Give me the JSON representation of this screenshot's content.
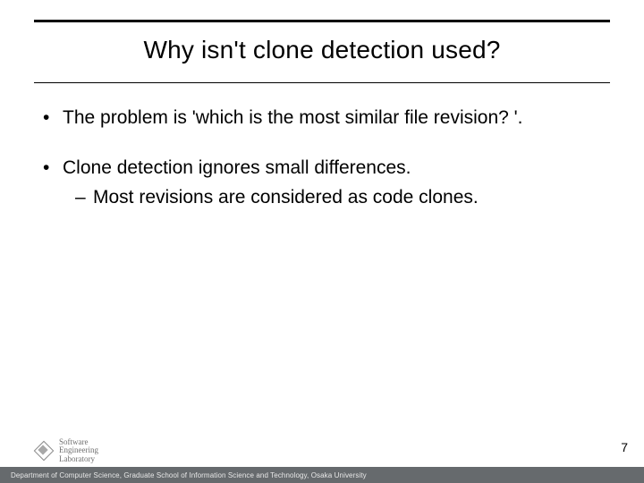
{
  "title": "Why isn't clone detection used?",
  "bullets": [
    {
      "text": "The problem is 'which is the most similar file revision? '.",
      "sub": []
    },
    {
      "text": "Clone detection ignores small differences.",
      "sub": [
        "Most revisions are considered as code clones."
      ]
    }
  ],
  "page_number": "7",
  "logo": {
    "line1": "Software",
    "line2": "Engineering",
    "line3": "Laboratory"
  },
  "footer": "Department of Computer Science, Graduate School of Information Science and Technology, Osaka University"
}
